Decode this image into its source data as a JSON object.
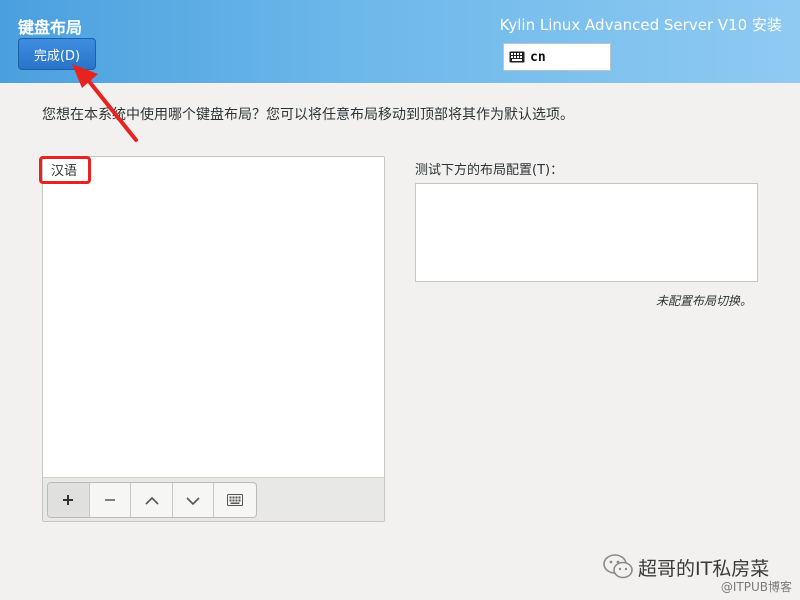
{
  "header": {
    "page_title": "键盘布局",
    "done_label": "完成(D)",
    "product_title": "Kylin Linux Advanced Server V10 安装",
    "layout_indicator": {
      "icon": "keyboard-icon",
      "code": "cn"
    }
  },
  "main": {
    "instruction": "您想在本系统中使用哪个键盘布局？您可以将任意布局移动到顶部将其作为默认选项。",
    "layouts": [
      {
        "label": "汉语"
      }
    ],
    "toolbar": [
      {
        "icon": "add-icon",
        "symbol": "+"
      },
      {
        "icon": "remove-icon",
        "symbol": "−"
      },
      {
        "icon": "move-up-icon"
      },
      {
        "icon": "move-down-icon"
      },
      {
        "icon": "keyboard-icon"
      }
    ],
    "test_label": "测试下方的布局配置(T)：",
    "test_value": "",
    "switch_note": "未配置布局切换。"
  },
  "annotations": {
    "accent": "#e8231f"
  },
  "watermark": {
    "name": "超哥的IT私房菜",
    "site": "@ITPUB博客"
  },
  "colors": {
    "header_blue": "#4aa0de",
    "button_blue": "#2a74c8",
    "background": "#f2f1f0"
  }
}
